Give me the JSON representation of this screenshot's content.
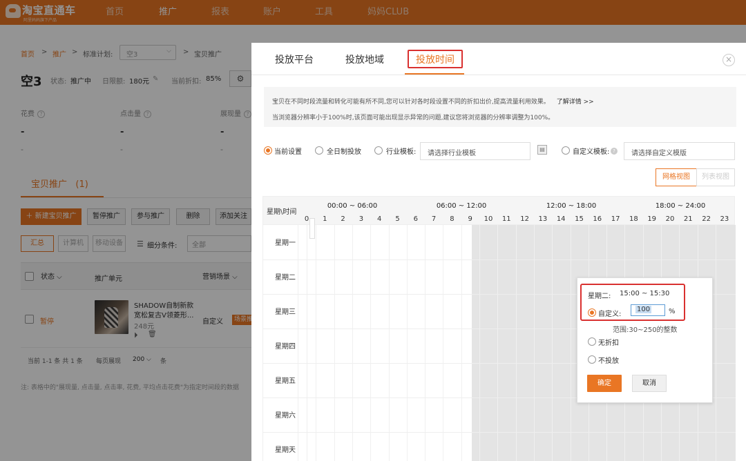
{
  "header": {
    "logo_title": "淘宝直通车",
    "logo_sub": "阿里妈妈旗下产品",
    "nav": [
      "首页",
      "推广",
      "报表",
      "账户",
      "工具",
      "妈妈CLUB"
    ]
  },
  "breadcrumb": {
    "home": "首页",
    "promo": "推广",
    "plan_label": "标准计划:",
    "plan_value": "空3",
    "current": "宝贝推广",
    "sep": ">"
  },
  "campaign": {
    "name": "空3",
    "status_label": "状态:",
    "status_value": "推广中",
    "budget_label": "日限额:",
    "budget_value": "180元",
    "discount_label": "当前折扣:",
    "discount_value": "85%"
  },
  "stats": {
    "labels": [
      "花费",
      "点击量",
      "展现量"
    ],
    "dash": "-"
  },
  "section": {
    "tab": "宝贝推广",
    "tab_count": "(1)"
  },
  "actions": {
    "new": "新建宝贝推广",
    "pause": "暂停推广",
    "join": "参与推广",
    "delete": "删除",
    "follow": "添加关注"
  },
  "filters": {
    "all": "汇总",
    "pc": "计算机",
    "mobile": "移动设备",
    "condition_label": "细分条件:",
    "condition_value": "全部"
  },
  "table": {
    "headers": [
      "状态",
      "推广单元",
      "营销场景"
    ],
    "row": {
      "status": "暂停",
      "title_line1": "SHADOW自制新款",
      "title_line2": "宽松复古V领菱形...",
      "price": "248元",
      "mode": "自定义",
      "scene": "场景推广"
    },
    "pager": {
      "summary": "当前 1-1 条  共 1 条",
      "per_page_label": "每页展现",
      "per_page": "200",
      "unit": "条"
    },
    "note": "注: 表格中的\"展现量, 点击量, 点击率, 花费, 平均点击花费\"为指定时间段的数据"
  },
  "modal": {
    "tabs": [
      "投放平台",
      "投放地域",
      "投放时间"
    ],
    "info_line1": "宝贝在不同时段流量和转化可能有所不同,您可以针对各时段设置不同的折扣出价,提高流量利用效果。",
    "info_link": "了解详情 >>",
    "info_line2": "当浏览器分辨率小于100%时,该页面可能出现显示异常的问题,建议您将浏览器的分辨率调整为100%。",
    "options": {
      "current": "当前设置",
      "all_day": "全日制投放",
      "industry": "行业模板:",
      "industry_placeholder": "请选择行业模板",
      "custom": "自定义模板:",
      "custom_placeholder": "请选择自定义模版"
    },
    "views": {
      "grid": "网格视图",
      "list": "列表视图"
    },
    "grid": {
      "corner": "星期\\时间",
      "ranges": [
        "00:00 ~ 06:00",
        "06:00 ~ 12:00",
        "12:00 ~ 18:00",
        "18:00 ~ 24:00"
      ],
      "hours": [
        "0",
        "1",
        "2",
        "3",
        "4",
        "5",
        "6",
        "7",
        "8",
        "9",
        "10",
        "11",
        "12",
        "13",
        "14",
        "15",
        "16",
        "17",
        "18",
        "19",
        "20",
        "21",
        "22",
        "23"
      ],
      "days": [
        "星期一",
        "星期二",
        "星期三",
        "星期四",
        "星期五",
        "星期六",
        "星期天"
      ]
    }
  },
  "popup": {
    "slot_day": "星期二:",
    "slot_time": "15:00 ~ 15:30",
    "custom_label": "自定义:",
    "custom_value": "100",
    "percent": "%",
    "range_hint": "范围:30~250的整数",
    "no_discount": "无折扣",
    "no_delivery": "不投放",
    "ok": "确定",
    "cancel": "取消"
  },
  "colors": {
    "brand": "#e97624",
    "highlight": "#d9302f"
  }
}
